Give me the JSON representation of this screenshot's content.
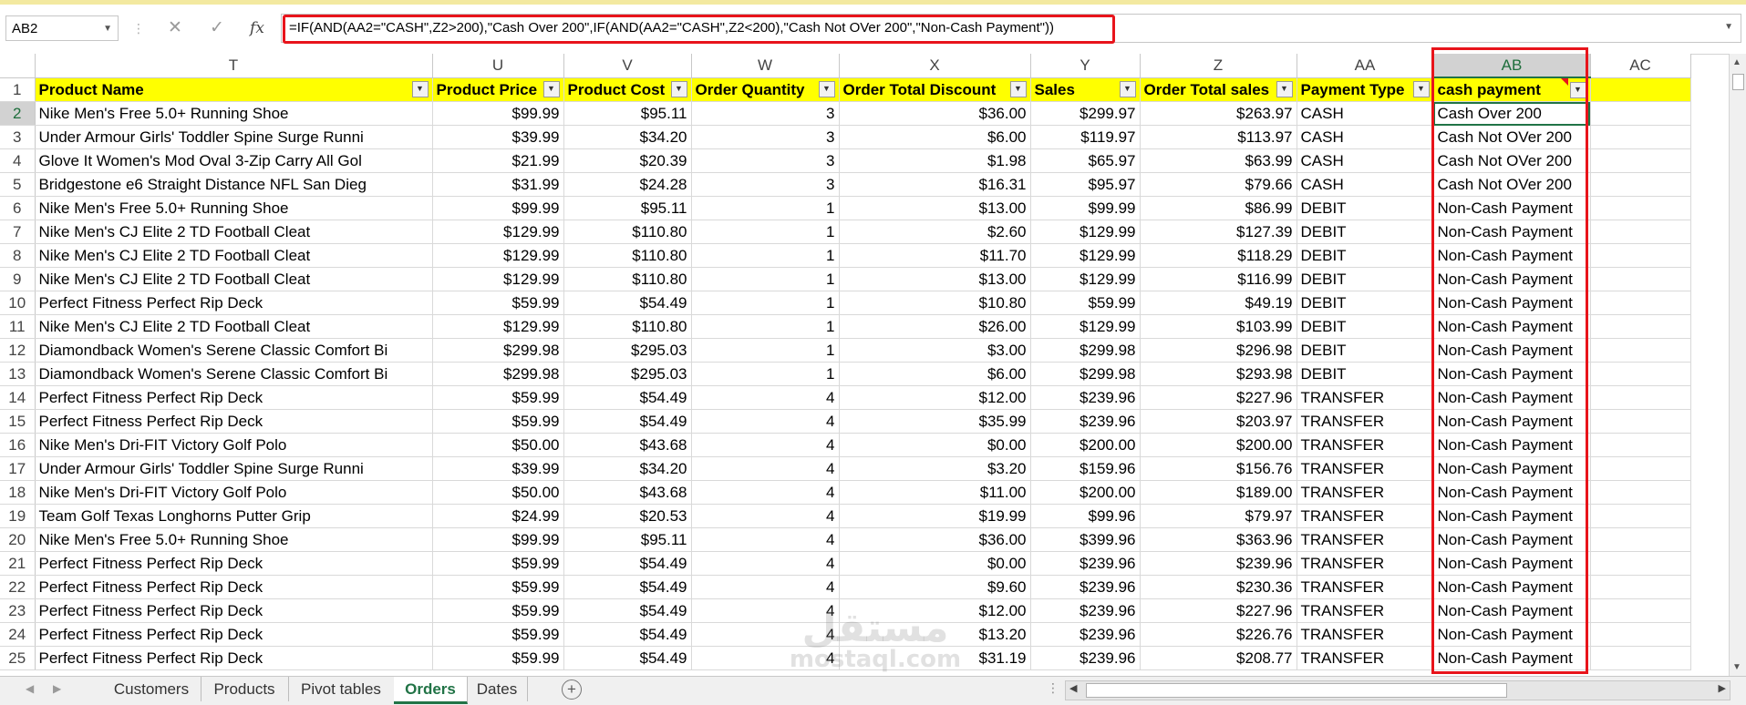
{
  "formula_bar": {
    "name_box": "AB2",
    "cancel_glyph": "✕",
    "enter_glyph": "✓",
    "fx_label": "fx",
    "formula": "=IF(AND(AA2=\"CASH\",Z2>200),\"Cash Over 200\",IF(AND(AA2=\"CASH\",Z2<200),\"Cash Not OVer 200\",\"Non-Cash Payment\"))"
  },
  "columns": [
    "T",
    "U",
    "V",
    "W",
    "X",
    "Y",
    "Z",
    "AA",
    "AB",
    "AC"
  ],
  "selected_column": "AB",
  "headers": [
    "Product Name",
    "Product Price",
    "Product Cost",
    "Order Quantity",
    "Order Total Discount",
    "Sales",
    "Order Total sales",
    "Payment Type",
    "cash payment"
  ],
  "rows": [
    {
      "n": "2",
      "c": [
        "Nike Men's Free 5.0+ Running Shoe",
        "$99.99",
        "$95.11",
        "3",
        "$36.00",
        "$299.97",
        "$263.97",
        "CASH",
        "Cash Over 200"
      ]
    },
    {
      "n": "3",
      "c": [
        "Under Armour Girls' Toddler Spine Surge Runni",
        "$39.99",
        "$34.20",
        "3",
        "$6.00",
        "$119.97",
        "$113.97",
        "CASH",
        "Cash Not OVer 200"
      ]
    },
    {
      "n": "4",
      "c": [
        "Glove It Women's Mod Oval 3-Zip Carry All Gol",
        "$21.99",
        "$20.39",
        "3",
        "$1.98",
        "$65.97",
        "$63.99",
        "CASH",
        "Cash Not OVer 200"
      ]
    },
    {
      "n": "5",
      "c": [
        "Bridgestone e6 Straight Distance NFL San Dieg",
        "$31.99",
        "$24.28",
        "3",
        "$16.31",
        "$95.97",
        "$79.66",
        "CASH",
        "Cash Not OVer 200"
      ]
    },
    {
      "n": "6",
      "c": [
        "Nike Men's Free 5.0+ Running Shoe",
        "$99.99",
        "$95.11",
        "1",
        "$13.00",
        "$99.99",
        "$86.99",
        "DEBIT",
        "Non-Cash Payment"
      ]
    },
    {
      "n": "7",
      "c": [
        "Nike Men's CJ Elite 2 TD Football Cleat",
        "$129.99",
        "$110.80",
        "1",
        "$2.60",
        "$129.99",
        "$127.39",
        "DEBIT",
        "Non-Cash Payment"
      ]
    },
    {
      "n": "8",
      "c": [
        "Nike Men's CJ Elite 2 TD Football Cleat",
        "$129.99",
        "$110.80",
        "1",
        "$11.70",
        "$129.99",
        "$118.29",
        "DEBIT",
        "Non-Cash Payment"
      ]
    },
    {
      "n": "9",
      "c": [
        "Nike Men's CJ Elite 2 TD Football Cleat",
        "$129.99",
        "$110.80",
        "1",
        "$13.00",
        "$129.99",
        "$116.99",
        "DEBIT",
        "Non-Cash Payment"
      ]
    },
    {
      "n": "10",
      "c": [
        "Perfect Fitness Perfect Rip Deck",
        "$59.99",
        "$54.49",
        "1",
        "$10.80",
        "$59.99",
        "$49.19",
        "DEBIT",
        "Non-Cash Payment"
      ]
    },
    {
      "n": "11",
      "c": [
        "Nike Men's CJ Elite 2 TD Football Cleat",
        "$129.99",
        "$110.80",
        "1",
        "$26.00",
        "$129.99",
        "$103.99",
        "DEBIT",
        "Non-Cash Payment"
      ]
    },
    {
      "n": "12",
      "c": [
        "Diamondback Women's Serene Classic Comfort Bi",
        "$299.98",
        "$295.03",
        "1",
        "$3.00",
        "$299.98",
        "$296.98",
        "DEBIT",
        "Non-Cash Payment"
      ]
    },
    {
      "n": "13",
      "c": [
        "Diamondback Women's Serene Classic Comfort Bi",
        "$299.98",
        "$295.03",
        "1",
        "$6.00",
        "$299.98",
        "$293.98",
        "DEBIT",
        "Non-Cash Payment"
      ]
    },
    {
      "n": "14",
      "c": [
        "Perfect Fitness Perfect Rip Deck",
        "$59.99",
        "$54.49",
        "4",
        "$12.00",
        "$239.96",
        "$227.96",
        "TRANSFER",
        "Non-Cash Payment"
      ]
    },
    {
      "n": "15",
      "c": [
        "Perfect Fitness Perfect Rip Deck",
        "$59.99",
        "$54.49",
        "4",
        "$35.99",
        "$239.96",
        "$203.97",
        "TRANSFER",
        "Non-Cash Payment"
      ]
    },
    {
      "n": "16",
      "c": [
        "Nike Men's Dri-FIT Victory Golf Polo",
        "$50.00",
        "$43.68",
        "4",
        "$0.00",
        "$200.00",
        "$200.00",
        "TRANSFER",
        "Non-Cash Payment"
      ]
    },
    {
      "n": "17",
      "c": [
        "Under Armour Girls' Toddler Spine Surge Runni",
        "$39.99",
        "$34.20",
        "4",
        "$3.20",
        "$159.96",
        "$156.76",
        "TRANSFER",
        "Non-Cash Payment"
      ]
    },
    {
      "n": "18",
      "c": [
        "Nike Men's Dri-FIT Victory Golf Polo",
        "$50.00",
        "$43.68",
        "4",
        "$11.00",
        "$200.00",
        "$189.00",
        "TRANSFER",
        "Non-Cash Payment"
      ]
    },
    {
      "n": "19",
      "c": [
        "Team Golf Texas Longhorns Putter Grip",
        "$24.99",
        "$20.53",
        "4",
        "$19.99",
        "$99.96",
        "$79.97",
        "TRANSFER",
        "Non-Cash Payment"
      ]
    },
    {
      "n": "20",
      "c": [
        "Nike Men's Free 5.0+ Running Shoe",
        "$99.99",
        "$95.11",
        "4",
        "$36.00",
        "$399.96",
        "$363.96",
        "TRANSFER",
        "Non-Cash Payment"
      ]
    },
    {
      "n": "21",
      "c": [
        "Perfect Fitness Perfect Rip Deck",
        "$59.99",
        "$54.49",
        "4",
        "$0.00",
        "$239.96",
        "$239.96",
        "TRANSFER",
        "Non-Cash Payment"
      ]
    },
    {
      "n": "22",
      "c": [
        "Perfect Fitness Perfect Rip Deck",
        "$59.99",
        "$54.49",
        "4",
        "$9.60",
        "$239.96",
        "$230.36",
        "TRANSFER",
        "Non-Cash Payment"
      ]
    },
    {
      "n": "23",
      "c": [
        "Perfect Fitness Perfect Rip Deck",
        "$59.99",
        "$54.49",
        "4",
        "$12.00",
        "$239.96",
        "$227.96",
        "TRANSFER",
        "Non-Cash Payment"
      ]
    },
    {
      "n": "24",
      "c": [
        "Perfect Fitness Perfect Rip Deck",
        "$59.99",
        "$54.49",
        "4",
        "$13.20",
        "$239.96",
        "$226.76",
        "TRANSFER",
        "Non-Cash Payment"
      ]
    },
    {
      "n": "25",
      "c": [
        "Perfect Fitness Perfect Rip Deck",
        "$59.99",
        "$54.49",
        "4",
        "$31.19",
        "$239.96",
        "$208.77",
        "TRANSFER",
        "Non-Cash Payment"
      ]
    }
  ],
  "sheet_tabs": {
    "tabs": [
      "Customers",
      "Products",
      "Pivot tables",
      "Orders",
      "Dates"
    ],
    "active": "Orders",
    "add_glyph": "+",
    "overflow_glyph": "⋮"
  },
  "watermark": {
    "arabic": "مستقل",
    "latin": "mostaql.com"
  },
  "colors": {
    "header_fill": "#ffff00",
    "highlight_border": "#e8141b",
    "accent": "#217346"
  }
}
